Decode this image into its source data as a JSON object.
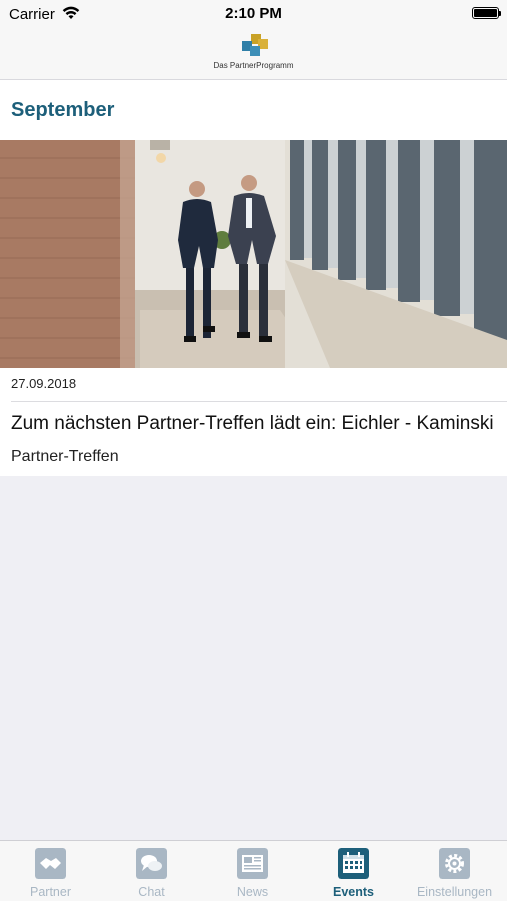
{
  "status_bar": {
    "carrier": "Carrier",
    "time": "2:10 PM",
    "icons": [
      "wifi-icon",
      "battery-icon"
    ]
  },
  "header": {
    "logo_text": "Das PartnerProgramm",
    "logo_colors": [
      "#c9a227",
      "#2f7fa8"
    ]
  },
  "section": {
    "title": "September"
  },
  "event": {
    "image_icon": "event-photo",
    "date": "27.09.2018",
    "title": "Zum nächsten Partner-Treffen lädt ein: Eichler - Kaminski",
    "category": "Partner-Treffen"
  },
  "tabs": [
    {
      "label": "Partner",
      "icon": "handshake-icon",
      "active": false
    },
    {
      "label": "Chat",
      "icon": "chat-bubbles-icon",
      "active": false
    },
    {
      "label": "News",
      "icon": "newspaper-icon",
      "active": false
    },
    {
      "label": "Events",
      "icon": "calendar-icon",
      "active": true
    },
    {
      "label": "Einstellungen",
      "icon": "gear-icon",
      "active": false
    }
  ],
  "colors": {
    "accent": "#1d5f7a",
    "inactive_tab": "#a9b7c4",
    "background": "#efeff4"
  }
}
